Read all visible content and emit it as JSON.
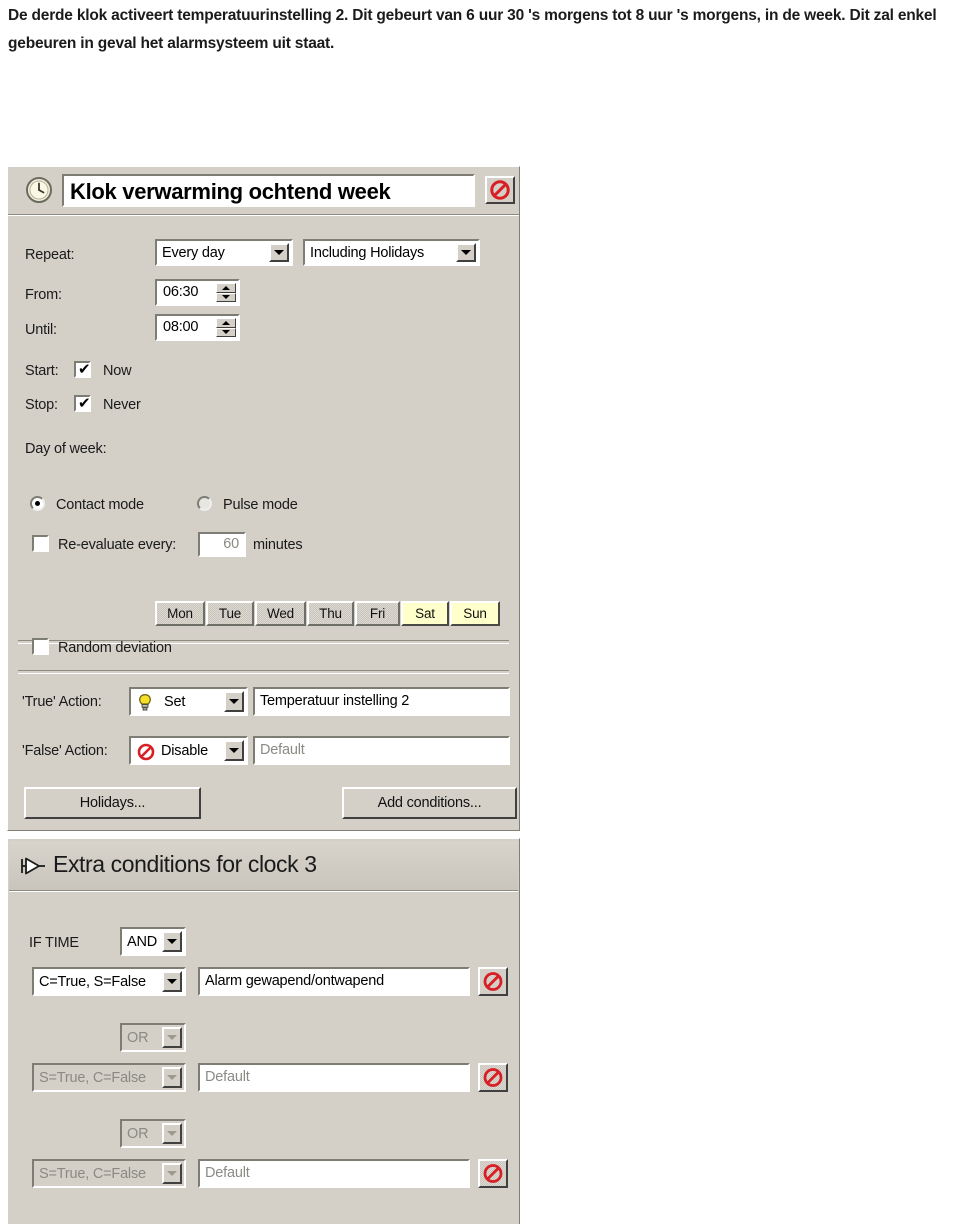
{
  "document": {
    "paragraph": "De derde klok activeert temperatuurinstelling 2. Dit gebeurt van 6 uur 30 's morgens tot 8 uur 's morgens, in de week. Dit zal enkel gebeuren in geval het alarmsysteem uit staat."
  },
  "clock_dialog": {
    "title_value": "Klok verwarming ochtend week",
    "title_icon": "clock-icon",
    "disable_button_icon": "no-entry-icon",
    "repeat": {
      "label": "Repeat:",
      "frequency_value": "Every day",
      "holidays_value": "Including Holidays"
    },
    "from": {
      "label": "From:",
      "value": "06:30"
    },
    "until": {
      "label": "Until:",
      "value": "08:00"
    },
    "start": {
      "label": "Start:",
      "checkbox_label": "Now",
      "checked": true
    },
    "stop": {
      "label": "Stop:",
      "checkbox_label": "Never",
      "checked": true
    },
    "day_of_week": {
      "label": "Day of week:",
      "days": [
        {
          "label": "Mon",
          "selected": false
        },
        {
          "label": "Tue",
          "selected": false
        },
        {
          "label": "Wed",
          "selected": false
        },
        {
          "label": "Thu",
          "selected": false
        },
        {
          "label": "Fri",
          "selected": false
        },
        {
          "label": "Sat",
          "selected": true
        },
        {
          "label": "Sun",
          "selected": true
        }
      ]
    },
    "mode": {
      "contact_label": "Contact mode",
      "contact_selected": true,
      "pulse_label": "Pulse mode",
      "pulse_selected": false
    },
    "reevaluate": {
      "label": "Re-evaluate every:",
      "checked": false,
      "value": "60",
      "unit_label": "minutes"
    },
    "random_deviation": {
      "label": "Random deviation",
      "checked": false
    },
    "true_action": {
      "label": "'True' Action:",
      "action_value": "Set",
      "action_icon": "lightbulb-icon",
      "target_value": "Temperatuur instelling 2"
    },
    "false_action": {
      "label": "'False' Action:",
      "action_value": "Disable",
      "action_icon": "no-entry-icon",
      "target_placeholder": "Default"
    },
    "holidays_button": "Holidays...",
    "add_conditions_button": "Add conditions..."
  },
  "conditions_panel": {
    "title": "Extra conditions for clock 3",
    "title_icon": "logic-gate-icon",
    "if_time_label": "IF TIME",
    "first_operator": "AND",
    "rows": [
      {
        "operator": "AND",
        "operator_enabled": true,
        "condition_value": "C=True, S=False",
        "target_value": "Alarm gewapend/ontwapend",
        "target_is_placeholder": false,
        "enabled": true,
        "delete_icon": "no-entry-icon"
      },
      {
        "operator": "OR",
        "operator_enabled": false,
        "condition_value": "S=True, C=False",
        "target_value": "Default",
        "target_is_placeholder": true,
        "enabled": false,
        "delete_icon": "no-entry-icon"
      },
      {
        "operator": "OR",
        "operator_enabled": false,
        "condition_value": "S=True, C=False",
        "target_value": "Default",
        "target_is_placeholder": true,
        "enabled": false,
        "delete_icon": "no-entry-icon"
      }
    ]
  },
  "colors": {
    "dialog_face": "#d4d0c8",
    "selected_day": "#ffffcc",
    "no_entry_red": "#d81f26",
    "bulb_yellow": "#f5e12a",
    "field_white": "#ffffff"
  }
}
